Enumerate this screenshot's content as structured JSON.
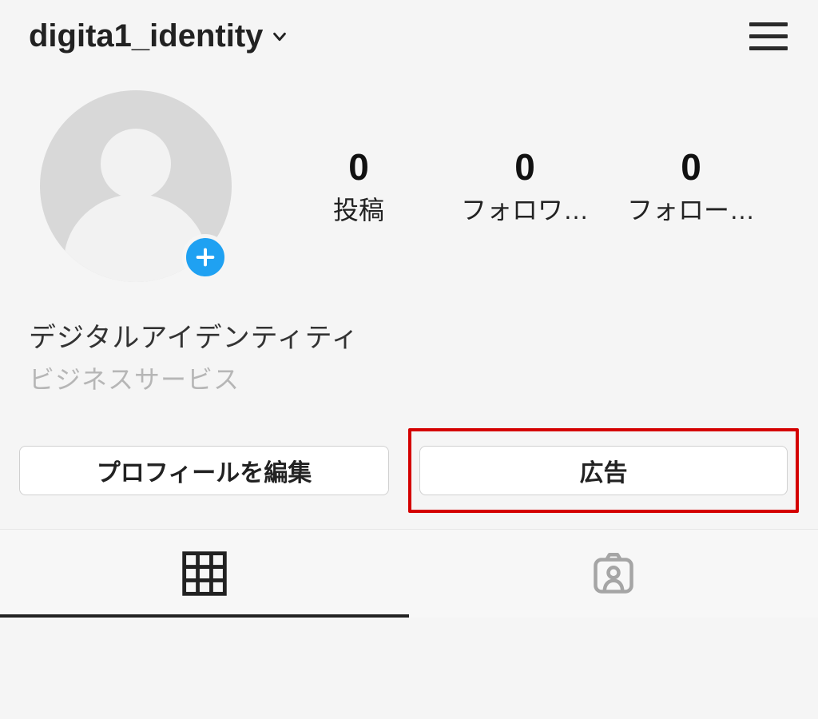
{
  "header": {
    "username": "digita1_identity"
  },
  "stats": {
    "posts": {
      "count": "0",
      "label": "投稿"
    },
    "followers": {
      "count": "0",
      "label": "フォロワ…"
    },
    "following": {
      "count": "0",
      "label": "フォロー…"
    }
  },
  "bio": {
    "display_name": "デジタルアイデンティティ",
    "category": "ビジネスサービス"
  },
  "buttons": {
    "edit_profile": "プロフィールを編集",
    "ads": "広告"
  },
  "icons": {
    "chevron_down": "chevron-down-icon",
    "hamburger": "hamburger-icon",
    "add": "add-icon",
    "grid": "grid-icon",
    "tagged": "tagged-icon"
  }
}
